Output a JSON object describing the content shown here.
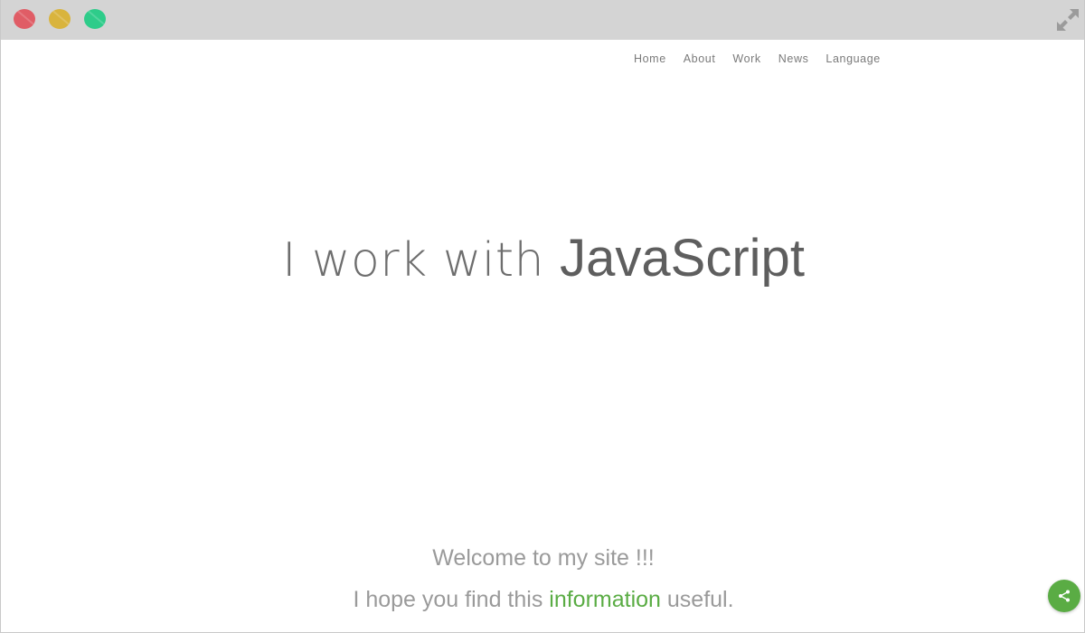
{
  "window": {
    "controls": {
      "close_color": "#e05d66",
      "minimize_color": "#d9b43d",
      "zoom_color": "#2ecc8a",
      "fullscreen_icon": "expand-arrows-icon"
    }
  },
  "nav": {
    "items": [
      {
        "label": "Home"
      },
      {
        "label": "About"
      },
      {
        "label": "Work"
      },
      {
        "label": "News"
      },
      {
        "label": "Language"
      }
    ]
  },
  "hero": {
    "prefix": "I work with ",
    "highlight": "JavaScript"
  },
  "welcome": {
    "line1": "Welcome to my site !!!",
    "line2_before": "I hope you find this ",
    "line2_accent": "information",
    "line2_after": " useful."
  },
  "share": {
    "icon": "share-icon",
    "color": "#5aac44"
  }
}
